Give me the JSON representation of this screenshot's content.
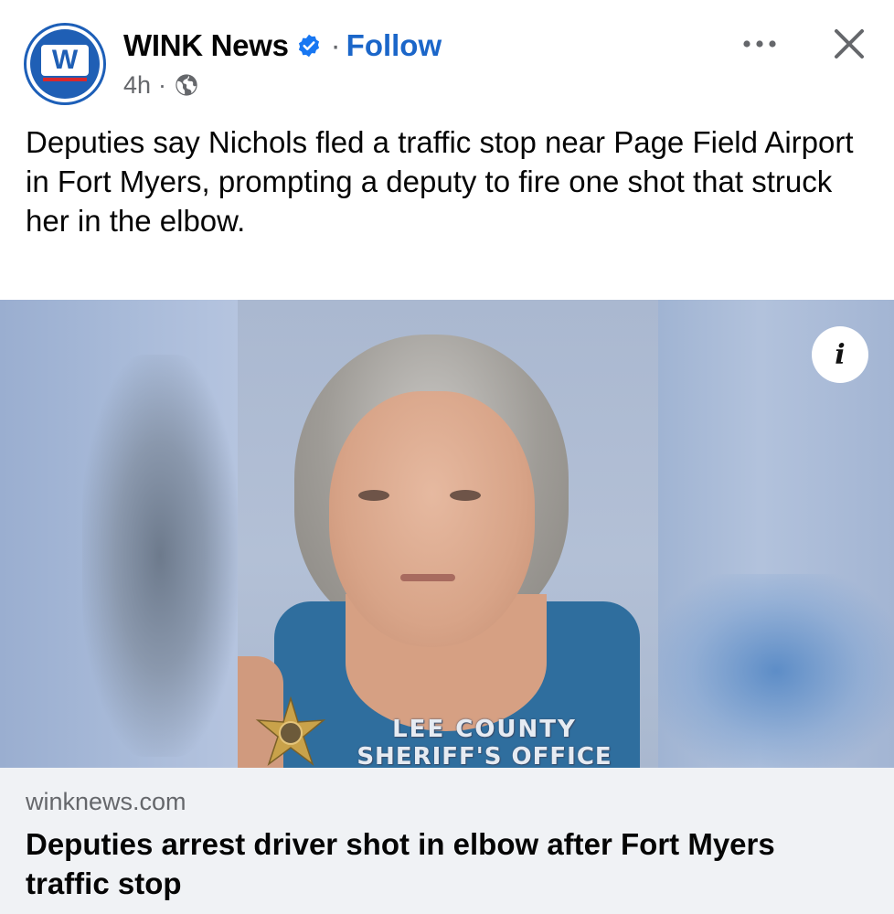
{
  "post": {
    "page_name": "WINK News",
    "avatar_letter": "W",
    "verified": true,
    "separator": "·",
    "follow_label": "Follow",
    "time": "4h",
    "meta_separator": "·",
    "audience_icon": "globe-icon",
    "more_icon": "more-options-icon",
    "close_icon": "close-icon",
    "caption": "Deputies say Nichols fled a traffic stop near Page Field Airport in Fort Myers, prompting a deputy to fire one shot that struck her in the elbow."
  },
  "media": {
    "watermark_line1": "LEE COUNTY",
    "watermark_line2": "SHERIFF'S OFFICE",
    "info_label": "i"
  },
  "link": {
    "domain": "winknews.com",
    "headline": "Deputies arrest driver shot in elbow after Fort Myers traffic stop"
  },
  "colors": {
    "brand_blue": "#1f5fb5",
    "follow_blue": "#1b66c9",
    "secondary_text": "#65676b",
    "card_background": "#f0f2f5"
  }
}
